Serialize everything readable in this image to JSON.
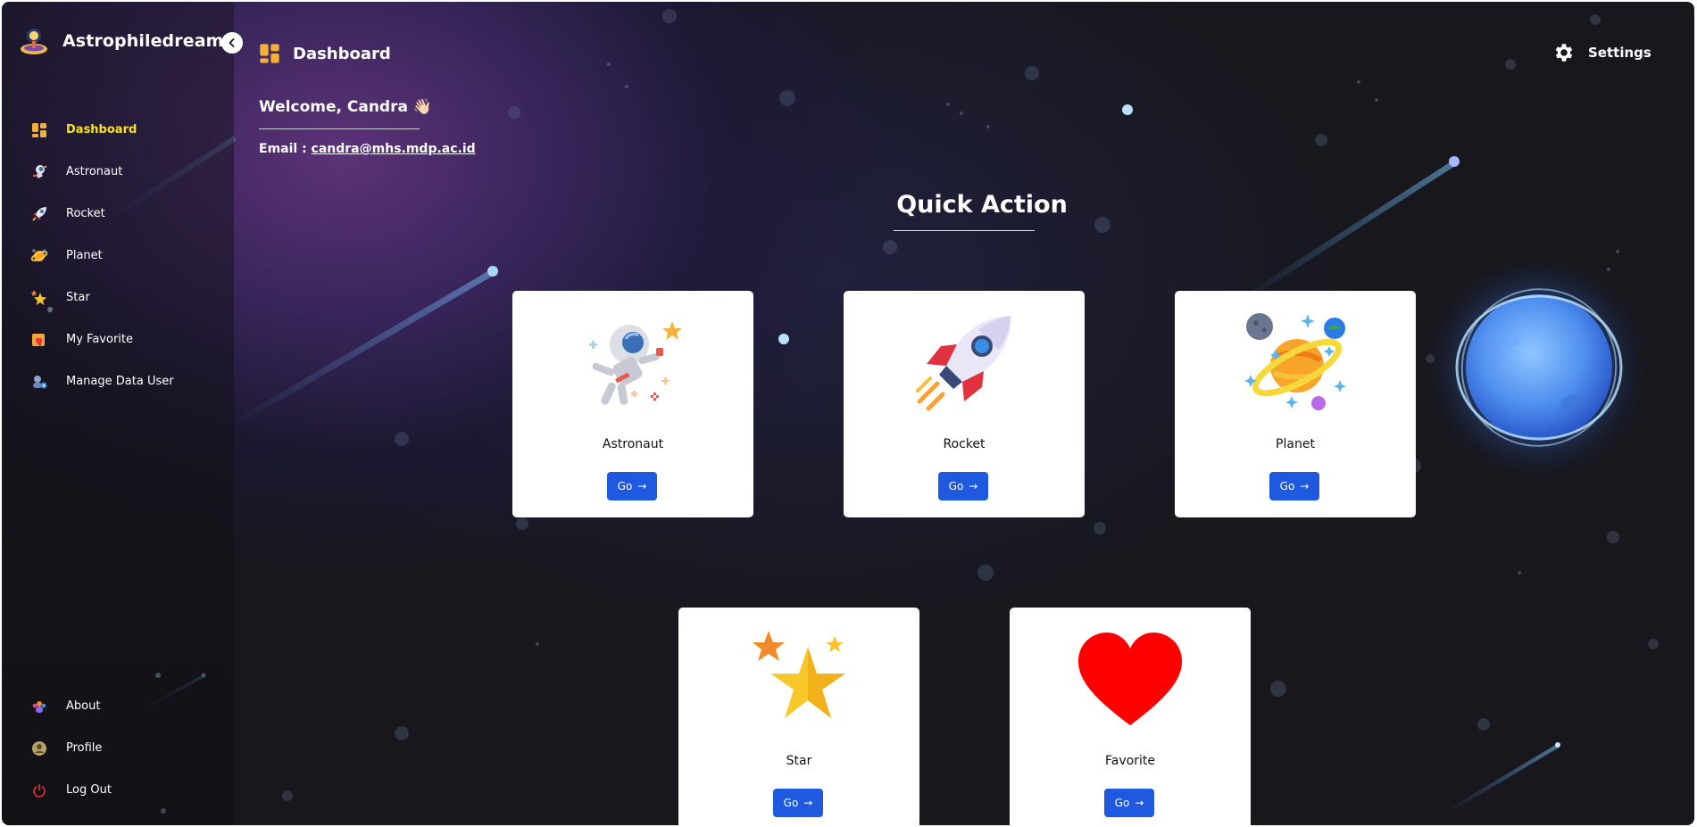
{
  "app": {
    "name": "Astrophiledream"
  },
  "sidebar": {
    "items": [
      {
        "label": "Dashboard",
        "icon": "dashboard-icon",
        "active": true
      },
      {
        "label": "Astronaut",
        "icon": "astronaut-icon"
      },
      {
        "label": "Rocket",
        "icon": "rocket-icon"
      },
      {
        "label": "Planet",
        "icon": "planet-icon"
      },
      {
        "label": "Star",
        "icon": "star-icon"
      },
      {
        "label": "My Favorite",
        "icon": "favorite-icon"
      },
      {
        "label": "Manage Data User",
        "icon": "manage-users-icon"
      }
    ],
    "bottom_items": [
      {
        "label": "About",
        "icon": "about-icon"
      },
      {
        "label": "Profile",
        "icon": "profile-icon"
      },
      {
        "label": "Log Out",
        "icon": "power-icon"
      }
    ]
  },
  "header": {
    "title": "Dashboard",
    "settings_label": "Settings"
  },
  "welcome": {
    "text": "Welcome, Candra 👋🏻",
    "email_label": "Email :",
    "email": "candra@mhs.mdp.ac.id"
  },
  "quick_action": {
    "title": "Quick Action",
    "cards": [
      {
        "name": "Astronaut",
        "button": "Go",
        "icon": "astronaut-illustration"
      },
      {
        "name": "Rocket",
        "button": "Go",
        "icon": "rocket-illustration"
      },
      {
        "name": "Planet",
        "button": "Go",
        "icon": "planet-illustration"
      },
      {
        "name": "Star",
        "button": "Go",
        "icon": "star-illustration"
      },
      {
        "name": "Favorite",
        "button": "Go",
        "icon": "heart-illustration"
      }
    ]
  },
  "colors": {
    "accent": "#f5e21b",
    "button": "#1f59e0",
    "background": "#17171d"
  }
}
